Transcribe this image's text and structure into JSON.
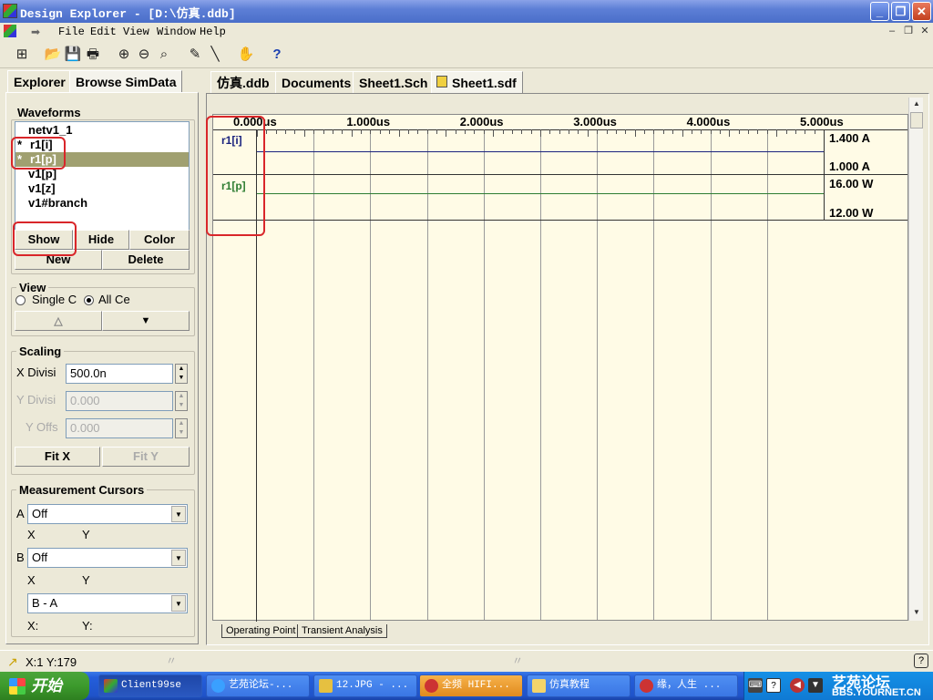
{
  "window": {
    "title": "Design Explorer - [D:\\仿真.ddb]"
  },
  "menu": {
    "items": [
      "File",
      "Edit",
      "View",
      "Window",
      "Help"
    ]
  },
  "left_panel": {
    "tabs": [
      "Explorer",
      "Browse SimData"
    ],
    "waveforms": {
      "title": "Waveforms",
      "items": [
        {
          "label": "netv1_1",
          "marker": ""
        },
        {
          "label": "r1[i]",
          "marker": "*"
        },
        {
          "label": "r1[p]",
          "marker": "*"
        },
        {
          "label": "v1[p]",
          "marker": ""
        },
        {
          "label": "v1[z]",
          "marker": ""
        },
        {
          "label": "v1#branch",
          "marker": ""
        }
      ],
      "buttons": {
        "show": "Show",
        "hide": "Hide",
        "color": "Color",
        "new": "New",
        "delete": "Delete"
      }
    },
    "view": {
      "title": "View",
      "single": "Single C",
      "all": "All Ce",
      "up_glyph": "△",
      "down_glyph": "▼"
    },
    "scaling": {
      "title": "Scaling",
      "x_label": "X Divisi",
      "x_value": "500.0n",
      "y_label": "Y Divisi",
      "y_value": "0.000",
      "yoff_label": "Y Offs",
      "yoff_value": "0.000",
      "fitx": "Fit X",
      "fity": "Fit Y"
    },
    "cursors": {
      "title": "Measurement Cursors",
      "a_label": "A",
      "a_value": "Off",
      "b_label": "B",
      "b_value": "Off",
      "x": "X",
      "y": "Y",
      "diff_value": "B - A",
      "x2": "X:",
      "y2": "Y:"
    }
  },
  "doc_tabs": [
    "仿真.ddb",
    "Documents",
    "Sheet1.Sch",
    "Sheet1.sdf"
  ],
  "plot": {
    "time_ticks": [
      "0.000us",
      "1.000us",
      "2.000us",
      "3.000us",
      "4.000us",
      "5.000us"
    ],
    "traces": [
      {
        "name": "r1[i]",
        "color": "#1a237e",
        "top_label": "1.400 A",
        "bottom_label": "1.000 A"
      },
      {
        "name": "r1[p]",
        "color": "#2e7d32",
        "top_label": "16.00 W",
        "bottom_label": "12.00 W"
      }
    ],
    "bottom_tabs": [
      "Operating Point",
      "Transient Analysis"
    ]
  },
  "statusbar": {
    "coords": "X:1 Y:179"
  },
  "taskbar": {
    "start": "开始",
    "buttons": [
      "Client99se",
      "艺苑论坛-...",
      "12.JPG - ...",
      "全频 HIFI...",
      "仿真教程",
      "缘，人生 ..."
    ],
    "watermark_top": "艺苑论坛",
    "watermark_bottom": "BBS.YOURNET.CN"
  },
  "colors": {
    "accent": "#d9262a",
    "selected": "#a0a070"
  }
}
